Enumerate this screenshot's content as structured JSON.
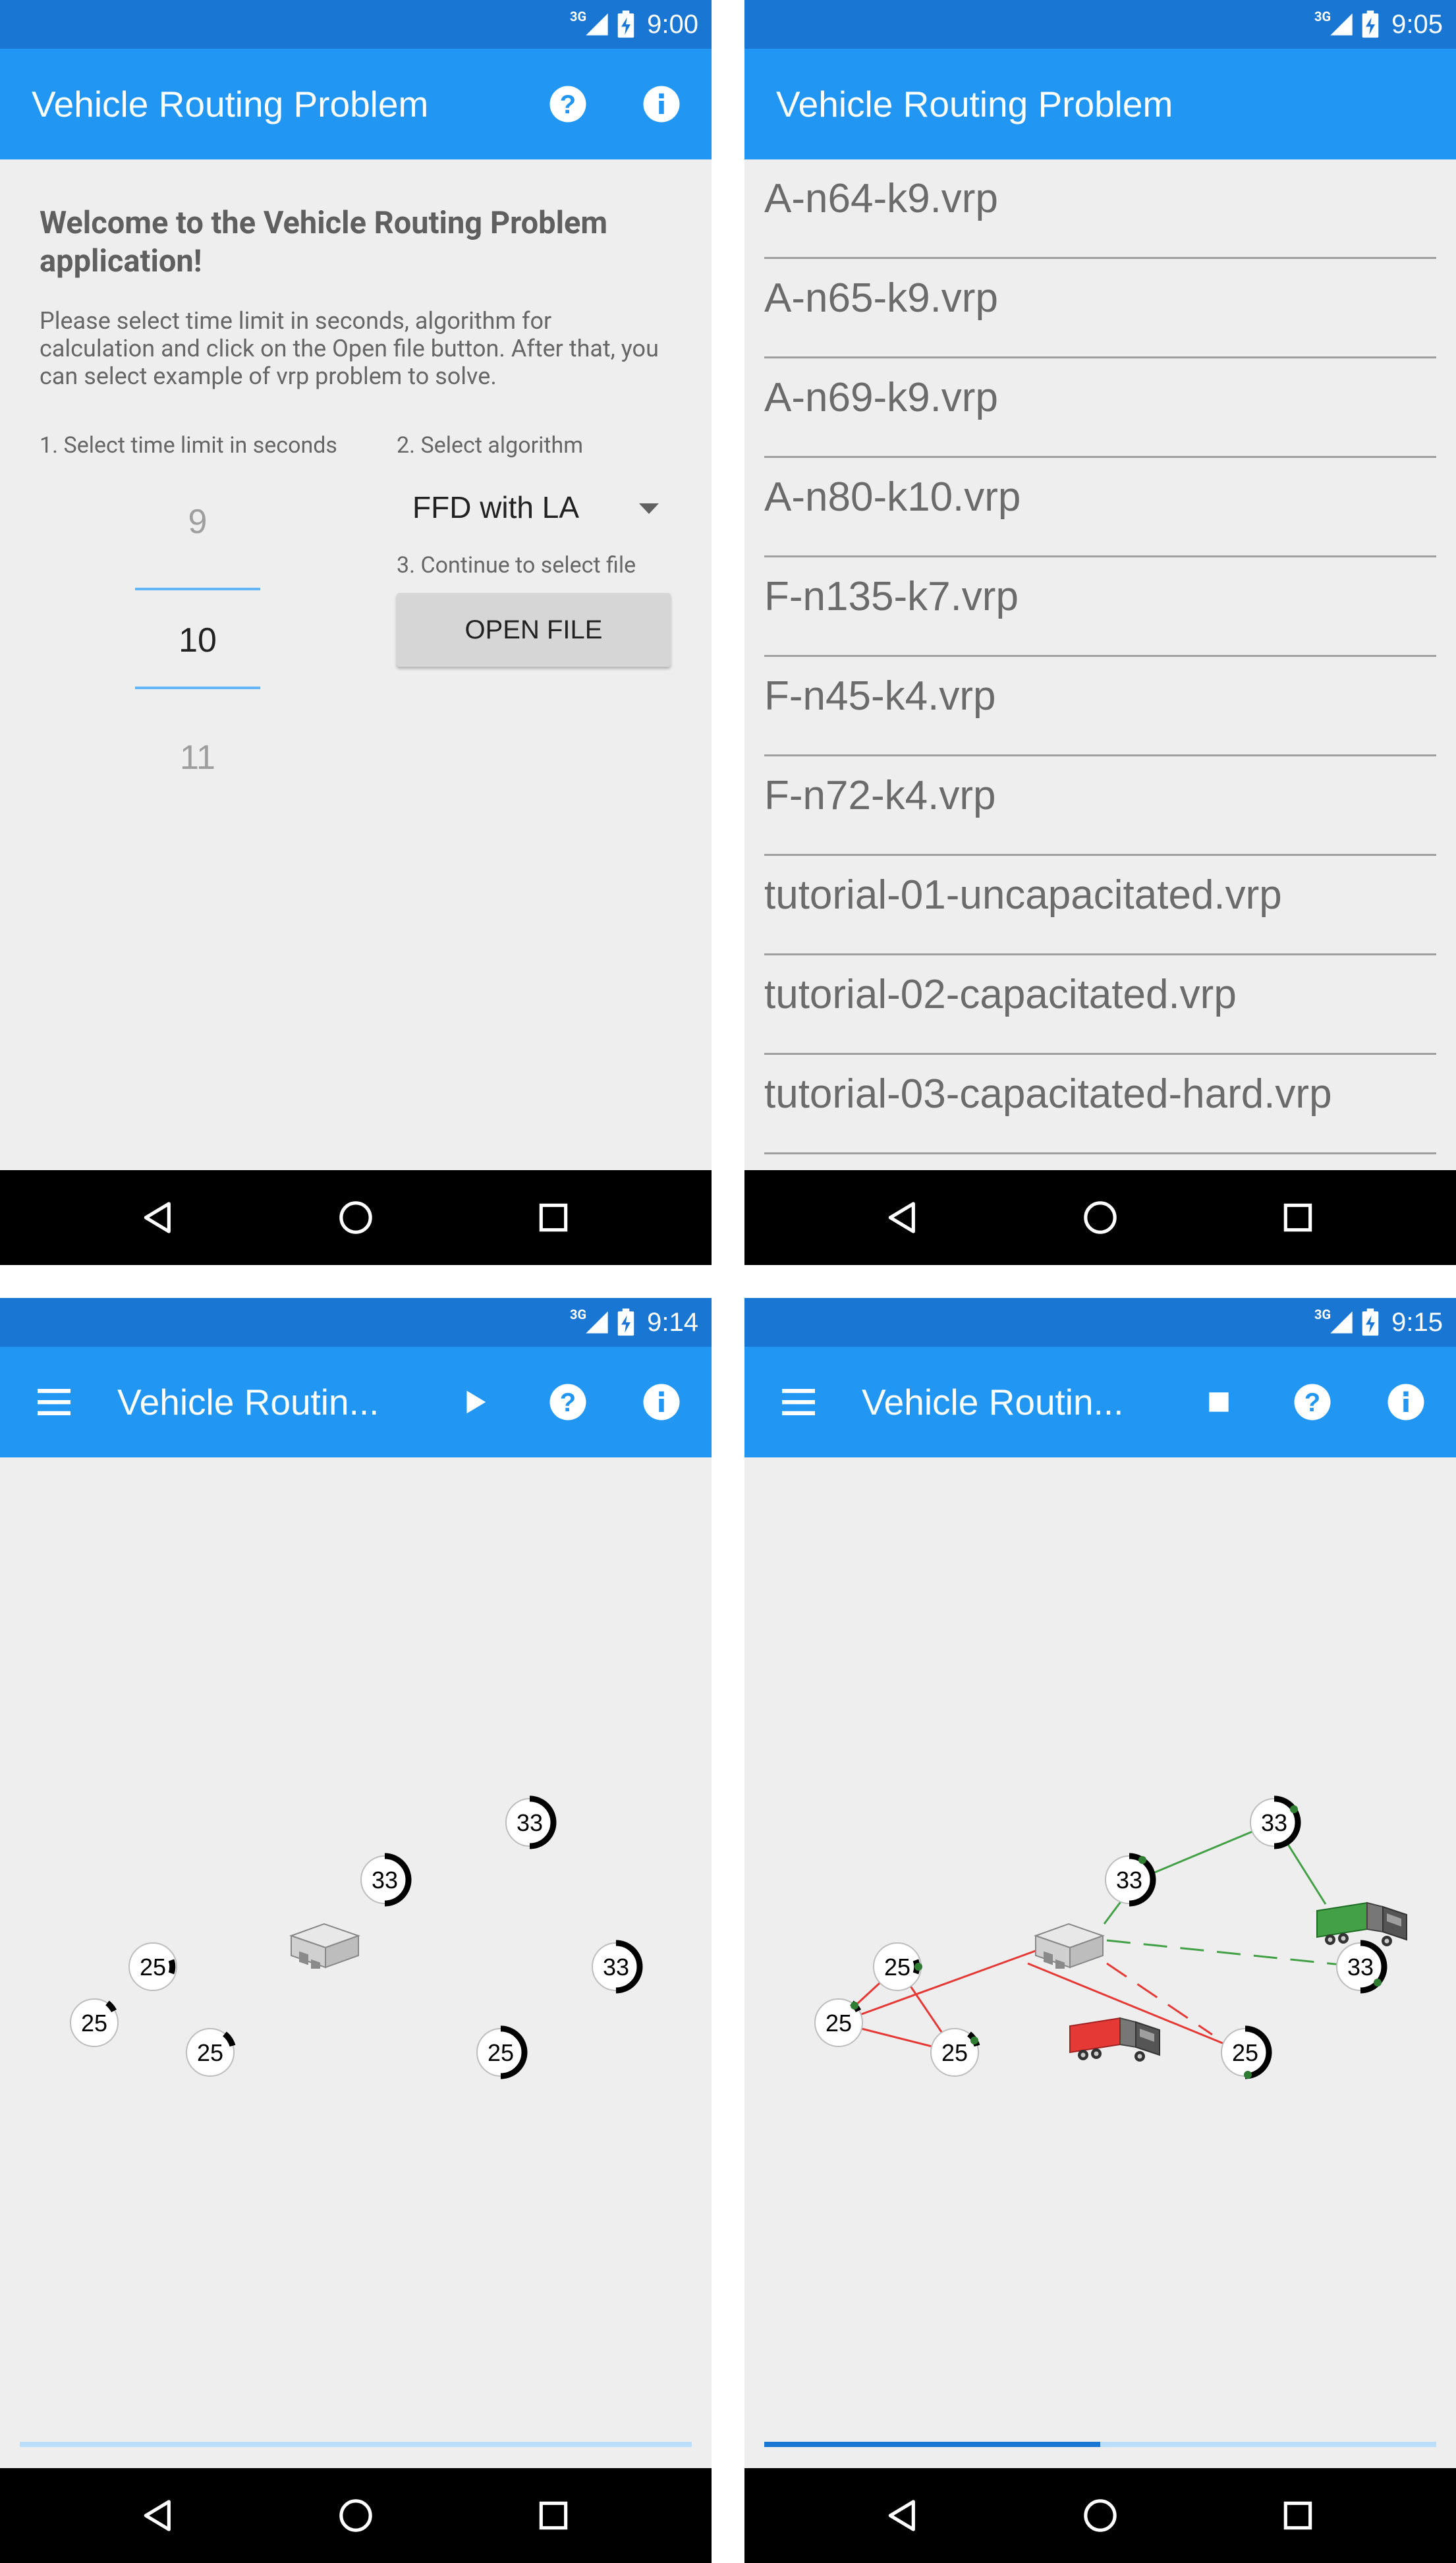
{
  "status": {
    "network": "3G",
    "times": [
      "9:00",
      "9:05",
      "9:14",
      "9:15"
    ]
  },
  "app": {
    "title": "Vehicle Routing Problem",
    "title_short": "Vehicle Routin..."
  },
  "welcome": {
    "heading": "Welcome to the Vehicle Routing Problem application!",
    "description": "Please select time limit in seconds, algorithm for calculation and click on the Open file button. After that, you can select example of vrp problem to solve.",
    "step1": "1. Select time limit in seconds",
    "step2": "2. Select algorithm",
    "step3": "3. Continue to select file",
    "time_prev": "9",
    "time_selected": "10",
    "time_next": "11",
    "algorithm": "FFD with LA",
    "open_button": "OPEN FILE"
  },
  "files": [
    "A-n64-k9.vrp",
    "A-n65-k9.vrp",
    "A-n69-k9.vrp",
    "A-n80-k10.vrp",
    "F-n135-k7.vrp",
    "F-n45-k4.vrp",
    "F-n72-k4.vrp",
    "tutorial-01-uncapacitated.vrp",
    "tutorial-02-capacitated.vrp",
    "tutorial-03-capacitated-hard.vrp"
  ],
  "map": {
    "demands": [
      "33",
      "33",
      "25",
      "25",
      "25",
      "25",
      "33"
    ],
    "progress_screen3": 0.0,
    "progress_screen4": 0.5
  },
  "colors": {
    "status_bar": "#1976d2",
    "app_bar": "#2196f3",
    "route_red": "#e53935",
    "route_green": "#43a047",
    "progress": "#1976d2",
    "progress_track": "#bbdefb"
  },
  "icons": {
    "help": "help-circle-icon",
    "info": "info-circle-icon",
    "menu": "hamburger-menu-icon",
    "play": "play-icon",
    "stop": "stop-icon",
    "back": "back-triangle-icon",
    "home": "home-circle-icon",
    "recents": "recents-square-icon"
  }
}
